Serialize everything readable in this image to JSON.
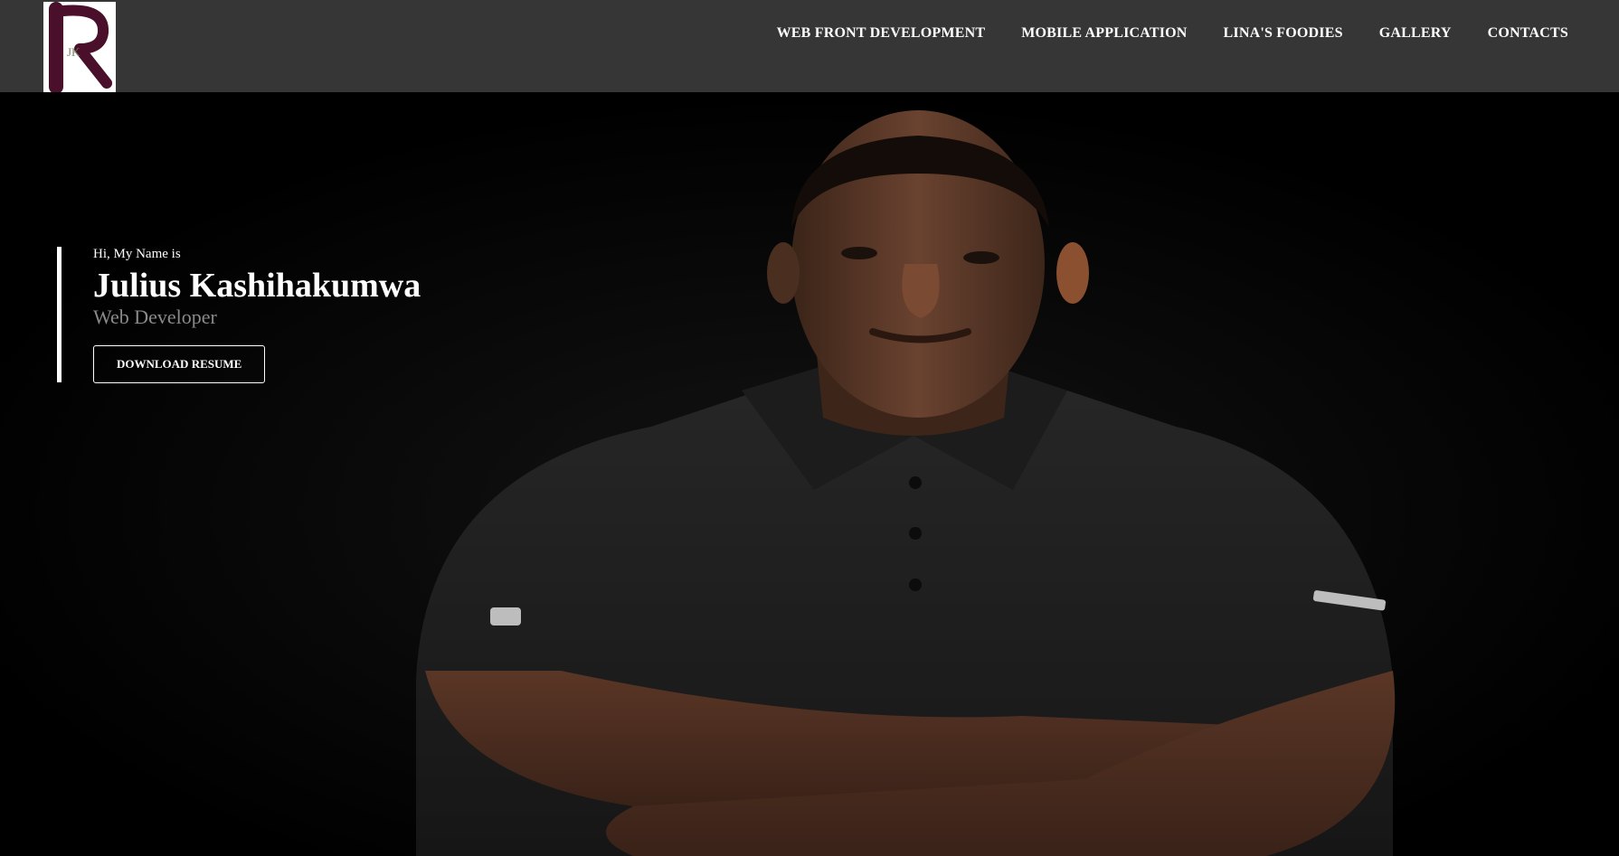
{
  "logo": {
    "alt": "JK logo",
    "initials": "JK"
  },
  "nav": {
    "items": [
      {
        "label": "WEB FRONT DEVELOPMENT"
      },
      {
        "label": "MOBILE APPLICATION"
      },
      {
        "label": "LINA'S FOODIES"
      },
      {
        "label": "GALLERY"
      },
      {
        "label": "CONTACTS"
      }
    ]
  },
  "hero": {
    "greeting": "Hi, My Name is",
    "name": "Julius Kashihakumwa",
    "role": "Web Developer",
    "button_label": "DOWNLOAD RESUME"
  },
  "colors": {
    "header_bg": "#363636",
    "logo_maroon": "#4a0f2a",
    "hero_bg": "#000000",
    "text": "#ffffff",
    "role_text": "#8a8a8a"
  }
}
